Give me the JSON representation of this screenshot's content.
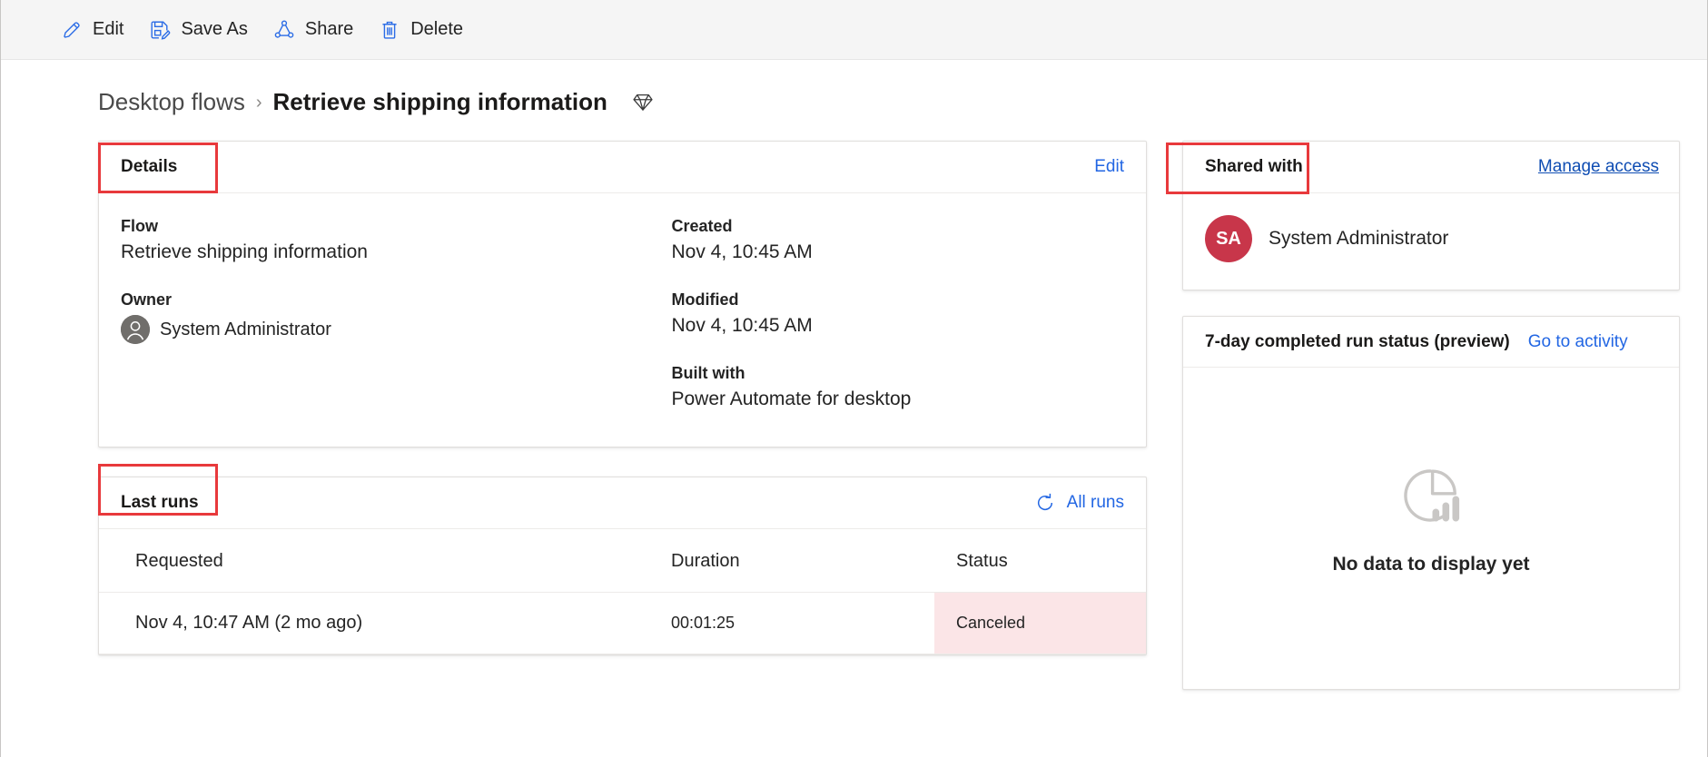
{
  "toolbar": {
    "buttons": [
      {
        "label": "Edit",
        "icon": "pencil-icon"
      },
      {
        "label": "Save As",
        "icon": "save-as-icon"
      },
      {
        "label": "Share",
        "icon": "share-icon"
      },
      {
        "label": "Delete",
        "icon": "trash-icon"
      }
    ]
  },
  "breadcrumb": {
    "parent": "Desktop flows",
    "separator": "›",
    "current": "Retrieve shipping information",
    "badge_icon": "gem-icon"
  },
  "details": {
    "title": "Details",
    "edit_link": "Edit",
    "fields": {
      "flow_label": "Flow",
      "flow_value": "Retrieve shipping information",
      "owner_label": "Owner",
      "owner_value": "System Administrator",
      "created_label": "Created",
      "created_value": "Nov 4, 10:45 AM",
      "modified_label": "Modified",
      "modified_value": "Nov 4, 10:45 AM",
      "built_with_label": "Built with",
      "built_with_value": "Power Automate for desktop"
    }
  },
  "last_runs": {
    "title": "Last runs",
    "all_runs_link": "All runs",
    "all_runs_icon": "refresh-icon",
    "columns": [
      "Requested",
      "Duration",
      "Status"
    ],
    "rows": [
      {
        "requested": "Nov 4, 10:47 AM (2 mo ago)",
        "duration": "00:01:25",
        "status": "Canceled",
        "status_bg": "#fbe5e7"
      }
    ]
  },
  "shared_with": {
    "title": "Shared with",
    "manage_access_link": "Manage access",
    "people": [
      {
        "initials": "SA",
        "name": "System Administrator",
        "avatar_color": "#c8364a"
      }
    ]
  },
  "run_status": {
    "title": "7-day completed run status (preview)",
    "activity_link": "Go to activity",
    "empty_icon": "pie-bar-chart-icon",
    "empty_text": "No data to display yet"
  },
  "colors": {
    "accent_blue": "#2266e3",
    "link_blue": "#0f6cbd",
    "highlight_red": "#e8393c",
    "avatar_red": "#c8364a",
    "status_canceled_bg": "#fbe5e7",
    "commandbar_bg": "#f5f5f5"
  }
}
